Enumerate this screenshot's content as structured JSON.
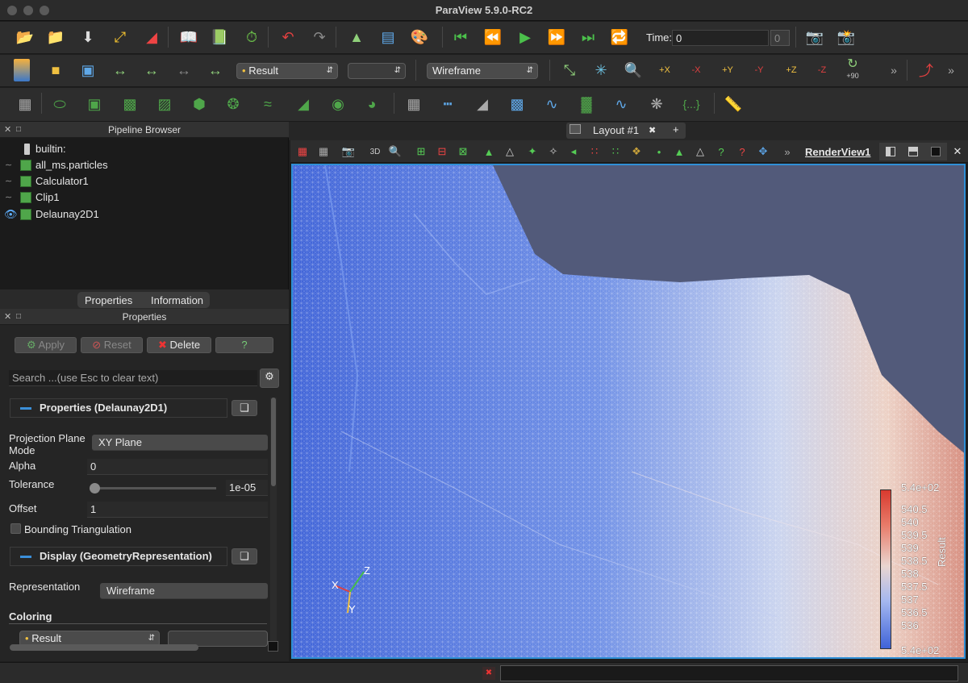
{
  "window": {
    "title": "ParaView 5.9.0-RC2"
  },
  "toolbar1": {
    "time_label": "Time:",
    "time_value": "0",
    "time_index": "0"
  },
  "toolbar2": {
    "color_by": "Result",
    "component": "",
    "representation": "Wireframe",
    "rotate_label": "+90",
    "camera_labels": [
      "+X",
      "-X",
      "+Y",
      "-Y",
      "+Z",
      "-Z"
    ]
  },
  "pipeline": {
    "header": "Pipeline Browser",
    "items": [
      {
        "label": "builtin:"
      },
      {
        "label": "all_ms.particles"
      },
      {
        "label": "Calculator1"
      },
      {
        "label": "Clip1"
      },
      {
        "label": "Delaunay2D1"
      }
    ]
  },
  "tabs": {
    "properties": "Properties",
    "information": "Information"
  },
  "properties": {
    "header": "Properties",
    "apply": "Apply",
    "reset": "Reset",
    "delete": "Delete",
    "help": "?",
    "search_placeholder": "Search ...(use Esc to clear text)",
    "section1": "Properties (Delaunay2D1)",
    "projection_label_1": "Projection Plane",
    "projection_label_2": "Mode",
    "projection_value": "XY Plane",
    "alpha_label": "Alpha",
    "alpha_value": "0",
    "tolerance_label": "Tolerance",
    "tolerance_value": "1e-05",
    "offset_label": "Offset",
    "offset_value": "1",
    "bounding_label": "Bounding Triangulation",
    "section2": "Display (GeometryRepresentation)",
    "representation_label": "Representation",
    "representation_value": "Wireframe",
    "coloring_label": "Coloring",
    "coloring_value": "Result"
  },
  "layout": {
    "tab": "Layout #1",
    "add": "+"
  },
  "renderview": {
    "name": "RenderView1",
    "label_3d": "3D"
  },
  "axes": {
    "x": "X",
    "y": "Y",
    "z": "Z"
  },
  "colorbar": {
    "title": "Result",
    "max_label": "5.4e+02",
    "min_label": "5.4e+02",
    "ticks": [
      "540.5",
      "540",
      "539.5",
      "539",
      "538.5",
      "538",
      "537.5",
      "537",
      "536.5",
      "536"
    ]
  },
  "colors": {
    "accent": "#2f8fd6",
    "green": "#4fa64a",
    "background": "#525a7a"
  }
}
